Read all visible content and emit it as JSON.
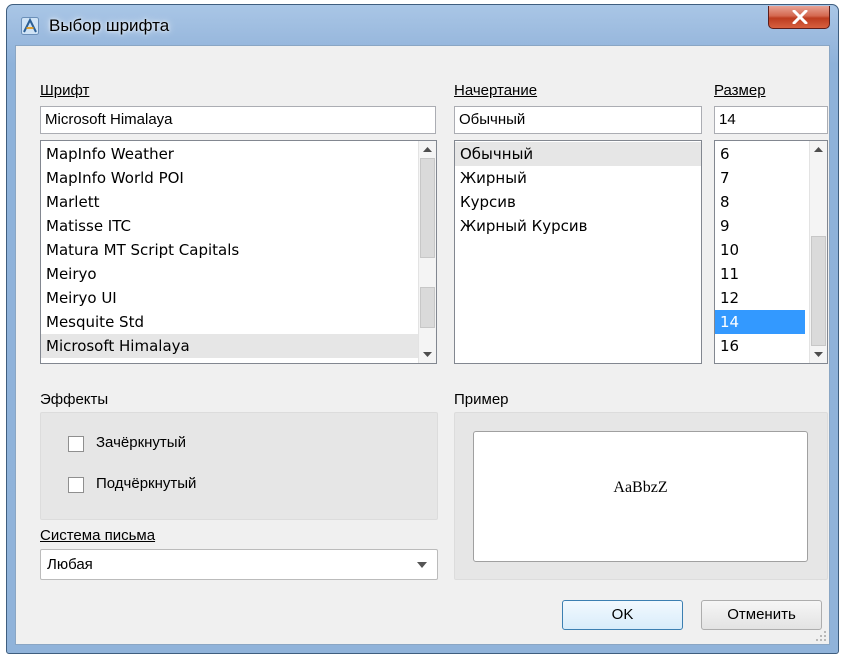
{
  "window": {
    "title": "Выбор шрифта"
  },
  "font": {
    "label": "Шрифт",
    "value": "Microsoft Himalaya",
    "items": [
      "MapInfo Weather",
      "MapInfo World POI",
      "Marlett",
      "Matisse ITC",
      "Matura MT Script Capitals",
      "Meiryo",
      "Meiryo UI",
      "Mesquite Std",
      "Microsoft Himalaya"
    ],
    "highlighted_index": 8
  },
  "style": {
    "label": "Начертание",
    "value": "Обычный",
    "items": [
      "Обычный",
      "Жирный",
      "Курсив",
      "Жирный Курсив"
    ],
    "highlighted_index": 0
  },
  "size": {
    "label": "Размер",
    "value": "14",
    "items": [
      "6",
      "7",
      "8",
      "9",
      "10",
      "11",
      "12",
      "14",
      "16"
    ],
    "selected_index": 7
  },
  "effects": {
    "label": "Эффекты",
    "strikeout_label": "Зачёркнутый",
    "strikeout_checked": false,
    "underline_label": "Подчёркнутый",
    "underline_checked": false
  },
  "writing_system": {
    "label": "Система письма",
    "value": "Любая"
  },
  "sample": {
    "label": "Пример",
    "text": "AaBbzZ"
  },
  "buttons": {
    "ok": "OK",
    "cancel": "Отменить"
  },
  "colors": {
    "selection": "#3399ff",
    "title_bar": "#9cbbdf",
    "dialog_bg": "#f0f0f0"
  },
  "icons": {
    "title": "font-dialog-icon",
    "close": "close-icon"
  }
}
